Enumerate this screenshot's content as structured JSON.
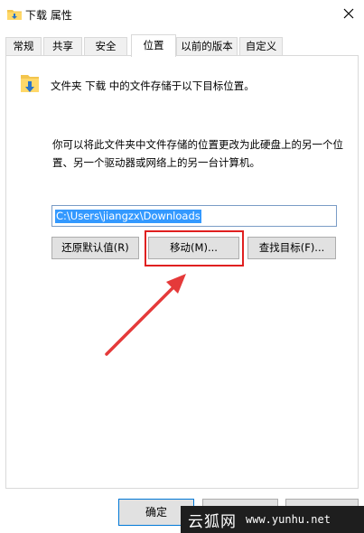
{
  "window": {
    "title": "下载 属性"
  },
  "tabs": [
    {
      "label": "常规"
    },
    {
      "label": "共享"
    },
    {
      "label": "安全"
    },
    {
      "label": "位置"
    },
    {
      "label": "以前的版本"
    },
    {
      "label": "自定义"
    }
  ],
  "active_tab": "位置",
  "location": {
    "intro": "文件夹 下载 中的文件存储于以下目标位置。",
    "description": "你可以将此文件夹中文件存储的位置更改为此硬盘上的另一个位置、另一个驱动器或网络上的另一台计算机。",
    "path_value": "C:\\Users\\jiangzx\\Downloads",
    "restore_default_label": "还原默认值(R)",
    "move_label": "移动(M)...",
    "find_target_label": "查找目标(F)..."
  },
  "footer": {
    "ok_label": "确定"
  },
  "watermark": {
    "name": "云狐网",
    "url": "www.yunhu.net"
  },
  "colors": {
    "selection": "#3399ff",
    "highlight": "#e02020",
    "accent": "#0078d7"
  },
  "icons": {
    "title": "folder-download-icon",
    "folder": "folder-download-icon",
    "close": "close-icon"
  }
}
